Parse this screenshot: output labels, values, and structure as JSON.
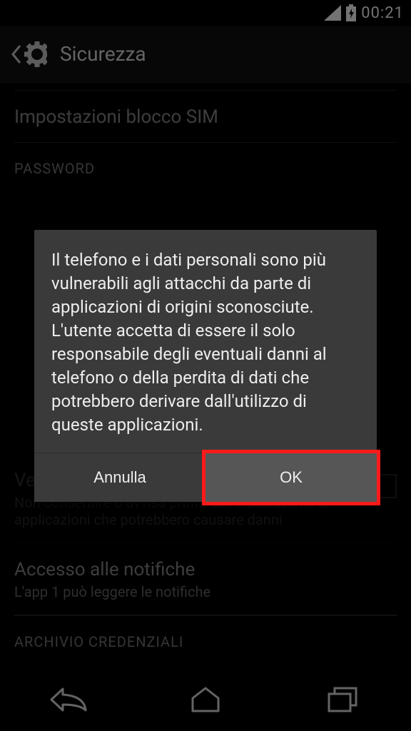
{
  "status": {
    "time": "00:21"
  },
  "header": {
    "title": "Sicurezza"
  },
  "sections": {
    "sim": {
      "title": "Impostazioni blocco SIM"
    },
    "password_header": "PASSWORD",
    "verify": {
      "title": "Verifica app",
      "sub": "Non consentire o avvisa prima dell'installazione di applicazioni che potrebbero causare danni"
    },
    "notif": {
      "title": "Accesso alle notifiche",
      "sub": "L'app 1 può leggere le notifiche"
    },
    "cred_header": "ARCHIVIO CREDENZIALI"
  },
  "dialog": {
    "message": "Il telefono e i dati personali sono più vulnerabili agli attacchi da parte di applicazioni di origini sconosciute. L'utente accetta di essere il solo responsabile degli eventuali danni al telefono o della perdita di dati che potrebbero derivare dall'utilizzo di queste applicazioni.",
    "cancel": "Annulla",
    "ok": "OK"
  }
}
